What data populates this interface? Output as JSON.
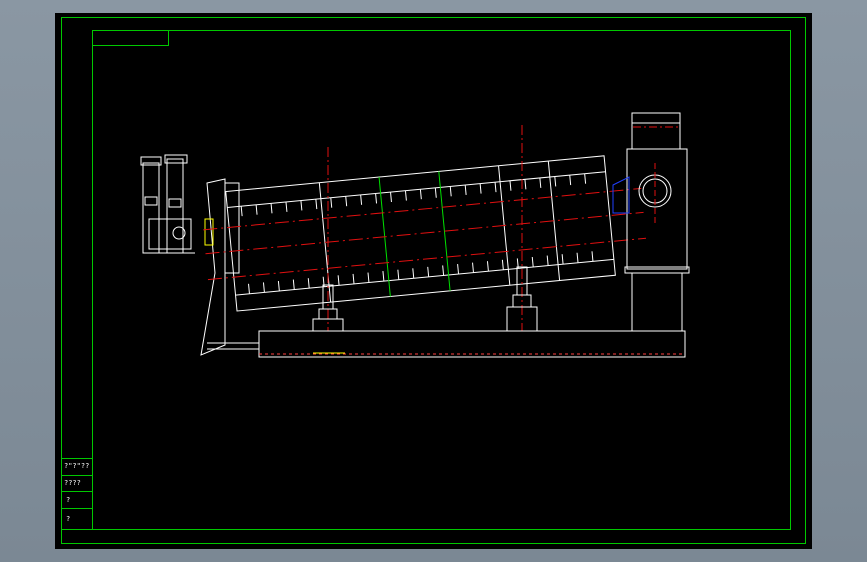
{
  "colors": {
    "background": "#7f8c98",
    "sheet": "#000000",
    "frame": "#00c800",
    "geometry": "#ffffff",
    "centerline": "#e01010",
    "hidden": "#00e000",
    "accent_blue": "#2040ff",
    "accent_yellow": "#ffff00"
  },
  "title_block": {
    "rows": [
      "?\"?\"??",
      "????",
      "?",
      "?"
    ]
  }
}
